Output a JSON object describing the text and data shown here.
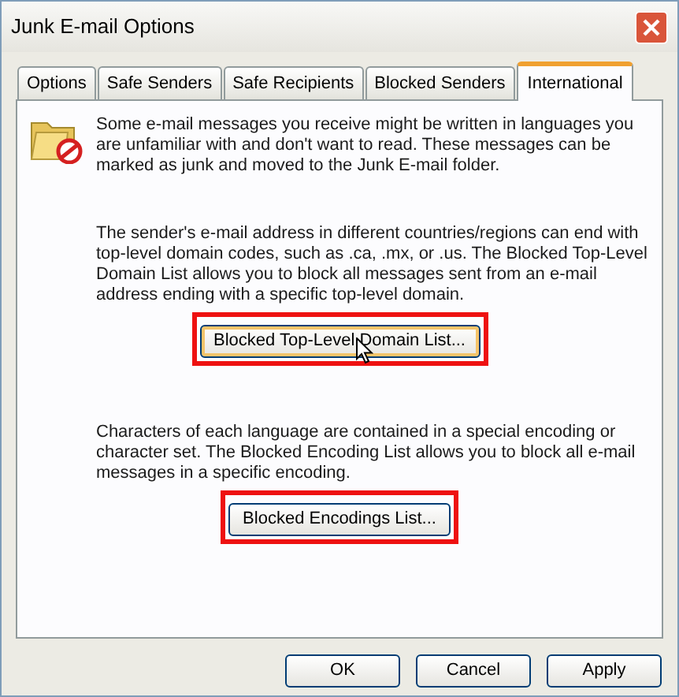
{
  "window": {
    "title": "Junk E-mail Options"
  },
  "tabs": [
    {
      "label": "Options",
      "selected": false
    },
    {
      "label": "Safe Senders",
      "selected": false
    },
    {
      "label": "Safe Recipients",
      "selected": false
    },
    {
      "label": "Blocked Senders",
      "selected": false
    },
    {
      "label": "International",
      "selected": true
    }
  ],
  "intro": "Some e-mail messages you receive might be written in languages you are unfamiliar with and don't want to read.  These messages can be marked as junk and moved to the Junk E-mail folder.",
  "sections": [
    {
      "text": "The sender's e-mail address in different countries/regions can end with top-level domain codes, such as .ca, .mx, or .us.  The Blocked Top-Level Domain List allows you to block all messages sent from an e-mail address ending with a specific top-level domain.",
      "button": "Blocked Top-Level Domain List...",
      "highlighted": true,
      "hovered": true
    },
    {
      "text": "Characters of each language are contained in a special encoding or character set.  The Blocked Encoding List allows you to block all e-mail messages in a specific encoding.",
      "button": "Blocked Encodings List...",
      "highlighted": true,
      "hovered": false
    }
  ],
  "buttons": [
    "OK",
    "Cancel",
    "Apply"
  ]
}
